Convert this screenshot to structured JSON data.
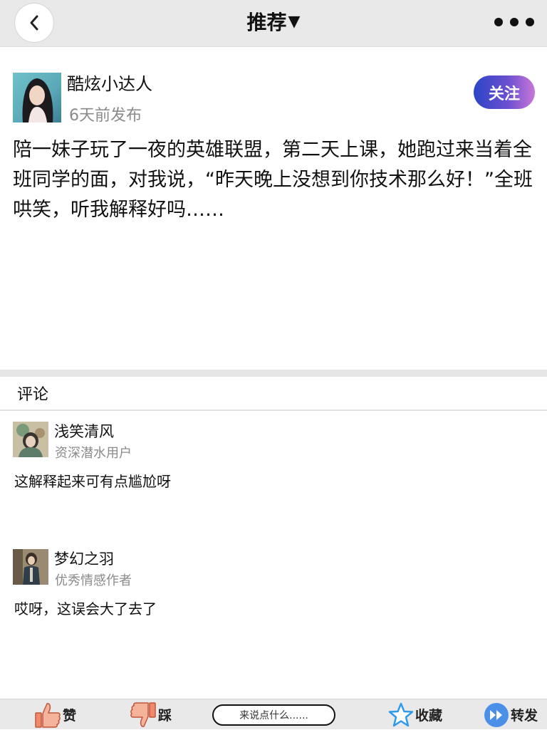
{
  "nav": {
    "title": "推荐",
    "caret": "▼"
  },
  "post": {
    "author": "酷炫小达人",
    "time": "6天前发布",
    "follow_label": "关注",
    "body": "陪一妹子玩了一夜的英雄联盟，第二天上课，她跑过来当着全班同学的面，对我说，“昨天晚上没想到你技术那么好！”全班哄笑，听我解释好吗……"
  },
  "comments_header": "评论",
  "comments": [
    {
      "name": "浅笑清风",
      "role": "资深潜水用户",
      "text": "这解释起来可有点尴尬呀"
    },
    {
      "name": "梦幻之羽",
      "role": "优秀情感作者",
      "text": "哎呀，这误会大了去了"
    }
  ],
  "bottom": {
    "like_label": "赞",
    "dislike_label": "踩",
    "input_placeholder": "来说点什么......",
    "favorite_label": "收藏",
    "share_label": "转发"
  },
  "colors": {
    "follow_gradient_start": "#2c45c8",
    "follow_gradient_end": "#c977d8",
    "star_blue": "#2f9be8",
    "share_blue": "#4a8fe8",
    "thumb_orange": "#f08a6a"
  },
  "icons": [
    "back-chevron-icon",
    "more-dots-icon",
    "thumbs-up-icon",
    "thumbs-down-icon",
    "star-icon",
    "share-forward-icon"
  ]
}
